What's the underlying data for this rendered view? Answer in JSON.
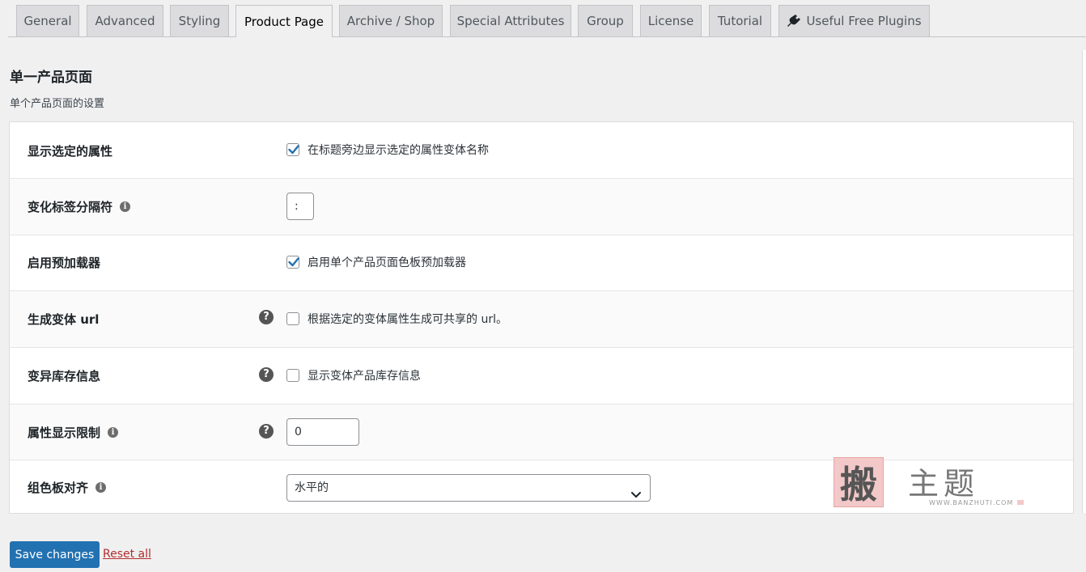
{
  "tabs": [
    {
      "label": "General"
    },
    {
      "label": "Advanced"
    },
    {
      "label": "Styling"
    },
    {
      "label": "Product Page",
      "active": true
    },
    {
      "label": "Archive / Shop"
    },
    {
      "label": "Special Attributes"
    },
    {
      "label": "Group"
    },
    {
      "label": "License"
    },
    {
      "label": "Tutorial"
    },
    {
      "label": "Useful Free Plugins",
      "icon": "plug-icon"
    }
  ],
  "section": {
    "title": "单一产品页面",
    "description": "单个产品页面的设置"
  },
  "settings": {
    "show_selected_attribute": {
      "label": "显示选定的属性",
      "checkbox_label": "在标题旁边显示选定的属性变体名称",
      "checked": true
    },
    "label_separator": {
      "label": "变化标签分隔符",
      "value": ":",
      "icon": "info-icon"
    },
    "enable_preloader": {
      "label": "启用预加载器",
      "checkbox_label": "启用单个产品页面色板预加载器",
      "checked": true
    },
    "generate_url": {
      "label": "生成变体 url",
      "checkbox_label": "根据选定的变体属性生成可共享的 url。",
      "checked": false,
      "icon": "help-icon"
    },
    "stock_info": {
      "label": "变异库存信息",
      "checkbox_label": "显示变体产品库存信息",
      "checked": false,
      "icon": "help-icon"
    },
    "display_limit": {
      "label": "属性显示限制",
      "value": "0",
      "icon": "info-icon",
      "help_icon": "help-icon"
    },
    "swatch_align": {
      "label": "组色板对齐",
      "selected": "水平的",
      "icon": "info-icon"
    }
  },
  "watermark": {
    "glyph": "搬",
    "text": "主题",
    "url": "WWW.BANZHUTI.COM"
  },
  "footer": {
    "save_label": "Save changes",
    "reset_label": "Reset all"
  },
  "colors": {
    "primary": "#2271b1",
    "reset": "#b32d2e",
    "background": "#f0f0f1"
  }
}
